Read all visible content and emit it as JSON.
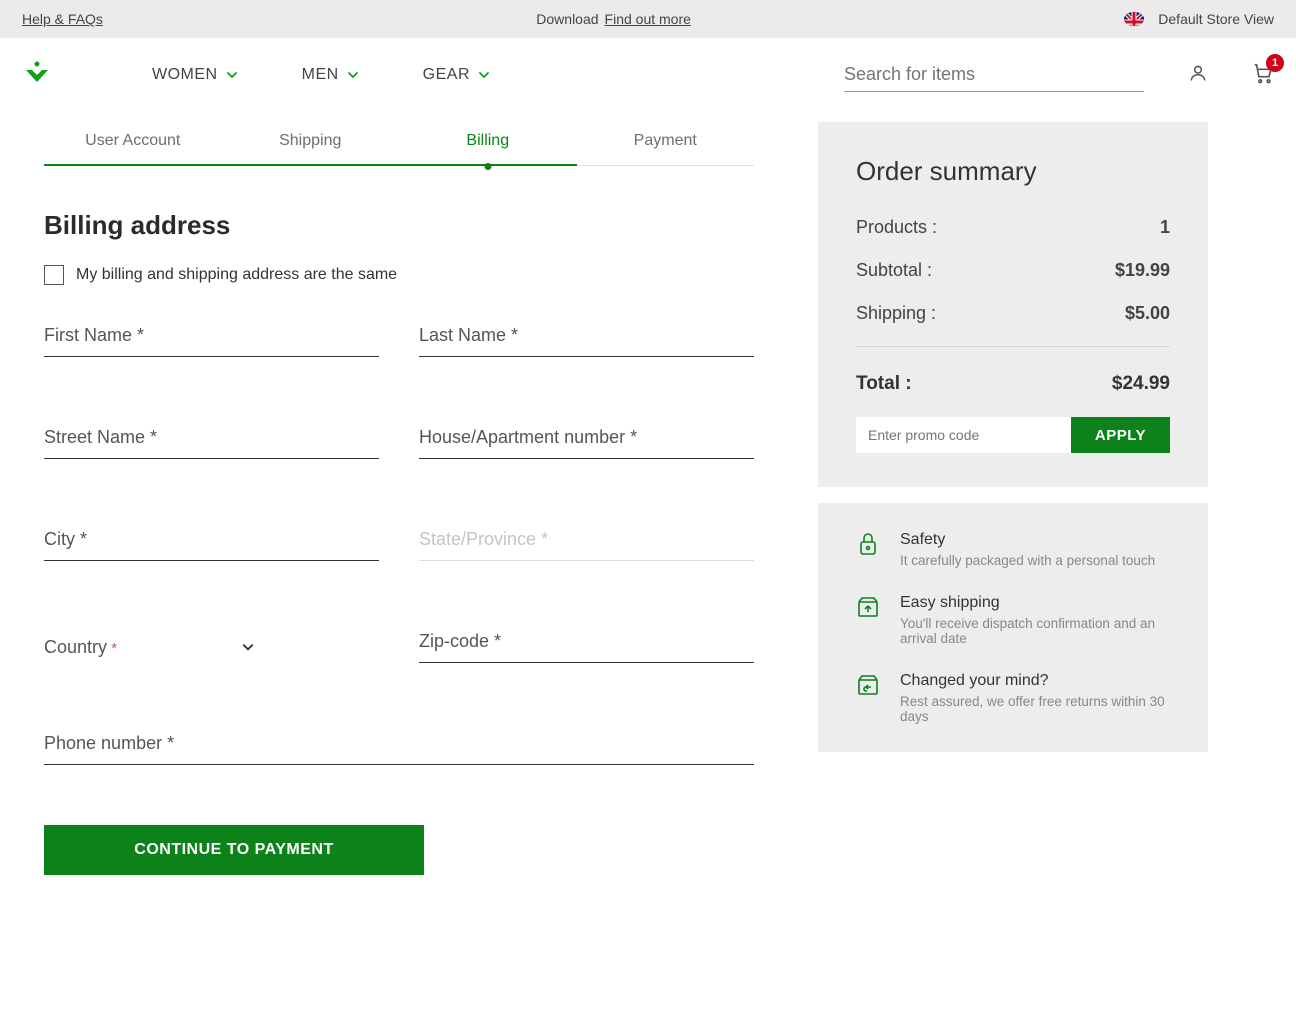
{
  "topbar": {
    "help_link": "Help & FAQs",
    "download_text": "Download",
    "find_out_link": "Find out more",
    "store_view": "Default Store View"
  },
  "nav": {
    "items": [
      "WOMEN",
      "MEN",
      "GEAR"
    ]
  },
  "search": {
    "placeholder": "Search for items"
  },
  "cart": {
    "count": "1"
  },
  "steps": [
    {
      "label": "User Account",
      "state": "done"
    },
    {
      "label": "Shipping",
      "state": "done"
    },
    {
      "label": "Billing",
      "state": "active"
    },
    {
      "label": "Payment",
      "state": "pending"
    }
  ],
  "billing": {
    "title": "Billing address",
    "same_address_label": "My billing and shipping address are the same",
    "fields": {
      "first_name": "First Name *",
      "last_name": "Last Name *",
      "street": "Street Name *",
      "house": "House/Apartment number *",
      "city": "City *",
      "state": "State/Province *",
      "country": "Country",
      "country_req": "*",
      "zip": "Zip-code *",
      "phone": "Phone number *"
    },
    "cta": "CONTINUE TO PAYMENT"
  },
  "summary": {
    "title": "Order summary",
    "rows": {
      "products_label": "Products :",
      "products_value": "1",
      "subtotal_label": "Subtotal :",
      "subtotal_value": "$19.99",
      "shipping_label": "Shipping :",
      "shipping_value": "$5.00",
      "total_label": "Total :",
      "total_value": "$24.99"
    },
    "promo_placeholder": "Enter promo code",
    "promo_apply": "APPLY"
  },
  "info": [
    {
      "title": "Safety",
      "desc": "It carefully packaged with a personal touch"
    },
    {
      "title": "Easy shipping",
      "desc": "You'll receive dispatch confirmation and an arrival date"
    },
    {
      "title": "Changed your mind?",
      "desc": "Rest assured, we offer free returns within 30 days"
    }
  ]
}
